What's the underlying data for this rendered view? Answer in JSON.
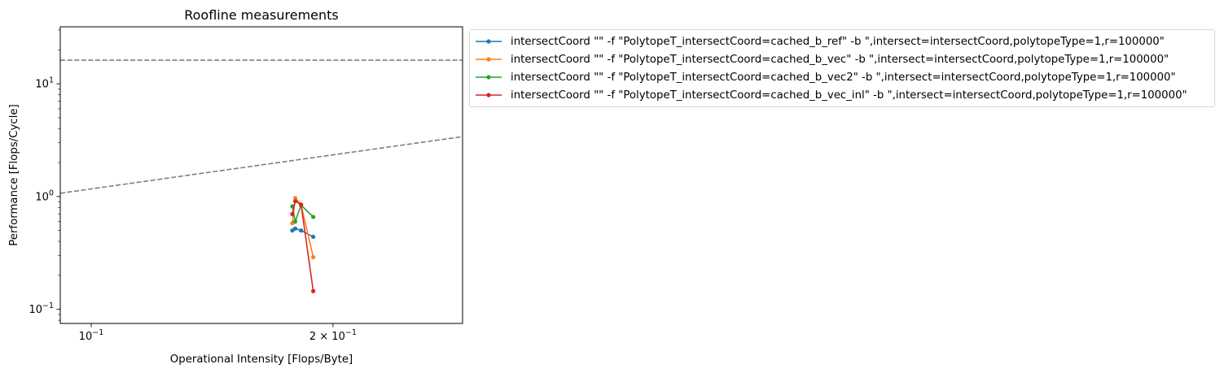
{
  "chart_data": {
    "type": "line",
    "title": "Roofline measurements",
    "xlabel": "Operational Intensity [Flops/Byte]",
    "ylabel": "Performance [Flops/Cycle]",
    "xscale": "log",
    "yscale": "log",
    "xlim": [
      0.0915,
      0.29
    ],
    "ylim": [
      0.075,
      32
    ],
    "x_ticks": [
      {
        "value": 0.1,
        "base": "10",
        "exp": "−1",
        "coef": ""
      },
      {
        "value": 0.2,
        "base": "10",
        "exp": "−1",
        "coef": "2 × "
      }
    ],
    "y_ticks": [
      {
        "value": 0.1,
        "base": "10",
        "exp": "−1"
      },
      {
        "value": 1,
        "base": "10",
        "exp": "0"
      },
      {
        "value": 10,
        "base": "10",
        "exp": "1"
      }
    ],
    "grid": false,
    "legend_position": "outside-right-top",
    "roofs": [
      {
        "name": "",
        "style": "dashed",
        "color": "#7f7f7f",
        "points": [
          [
            0.0915,
            16.2
          ],
          [
            0.29,
            16.2
          ]
        ]
      },
      {
        "name": "",
        "style": "dashed",
        "color": "#7f7f7f",
        "points": [
          [
            0.0915,
            1.07
          ],
          [
            0.29,
            3.4
          ]
        ]
      }
    ],
    "series": [
      {
        "name": "intersectCoord \"\" -f \"PolytopeT_intersectCoord=cached_b_ref\" -b \",intersect=intersectCoord,polytopeType=1,r=100000\"",
        "color": "#1f77b4",
        "points": [
          [
            0.178,
            0.5
          ],
          [
            0.1795,
            0.52
          ],
          [
            0.1825,
            0.5
          ],
          [
            0.189,
            0.44
          ]
        ]
      },
      {
        "name": "intersectCoord \"\" -f \"PolytopeT_intersectCoord=cached_b_vec\" -b \",intersect=intersectCoord,polytopeType=1,r=100000\"",
        "color": "#ff7f0e",
        "points": [
          [
            0.178,
            0.58
          ],
          [
            0.1795,
            0.97
          ],
          [
            0.1825,
            0.85
          ],
          [
            0.189,
            0.29
          ]
        ]
      },
      {
        "name": "intersectCoord \"\" -f \"PolytopeT_intersectCoord=cached_b_vec2\" -b \",intersect=intersectCoord,polytopeType=1,r=100000\"",
        "color": "#2ca02c",
        "points": [
          [
            0.178,
            0.82
          ],
          [
            0.1795,
            0.6
          ],
          [
            0.1825,
            0.84
          ],
          [
            0.189,
            0.66
          ]
        ]
      },
      {
        "name": "intersectCoord \"\" -f \"PolytopeT_intersectCoord=cached_b_vec_inl\" -b \",intersect=intersectCoord,polytopeType=1,r=100000\"",
        "color": "#d62728",
        "points": [
          [
            0.178,
            0.7
          ],
          [
            0.1795,
            0.91
          ],
          [
            0.1825,
            0.85
          ],
          [
            0.189,
            0.145
          ]
        ]
      }
    ]
  }
}
